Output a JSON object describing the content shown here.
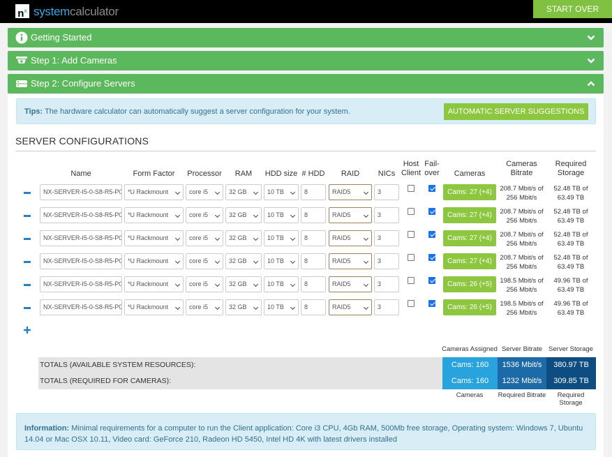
{
  "header": {
    "logo_mark": "n",
    "logo_sup": "x",
    "logo_brand": "system",
    "logo_rest": "calculator",
    "start_over_label": "START OVER"
  },
  "accordion": [
    {
      "label": "Getting Started",
      "icon": "info-circle-icon",
      "state": "collapsed"
    },
    {
      "label": "Step 1: Add Cameras",
      "icon": "camera-icon",
      "state": "collapsed"
    },
    {
      "label": "Step 2: Configure Servers",
      "icon": "server-icon",
      "state": "expanded"
    }
  ],
  "tips": {
    "label": "Tips:",
    "text": "The hardware calculator can automatically suggest a server configuration for your system.",
    "button": "AUTOMATIC SERVER SUGGESTIONS"
  },
  "section_title": "SERVER CONFIGURATIONS",
  "columns": {
    "name": "Name",
    "form_factor": "Form Factor",
    "processor": "Processor",
    "ram": "RAM",
    "hdd_size": "HDD size",
    "num_hdd": "# HDD",
    "raid": "RAID",
    "nics": "NICs",
    "host_client_1": "Host",
    "host_client_2": "Client",
    "failover_1": "Fail-",
    "failover_2": "over",
    "cameras": "Cameras",
    "bitrate_1": "Cameras",
    "bitrate_2": "Bitrate",
    "storage_1": "Required",
    "storage_2": "Storage"
  },
  "servers": [
    {
      "name": "NX-SERVER-I5-0-S8-R5-P0",
      "form_factor": "*U Rackmount",
      "processor": "core i5",
      "ram": "32 GB",
      "hdd_size": "10 TB",
      "num_hdd": "8",
      "raid": "RAID5",
      "nics": "3",
      "host_client": false,
      "failover": true,
      "cameras": "Cams: 27 (+4)",
      "bitrate_1": "208.7 Mbit/s of",
      "bitrate_2": "256 Mbit/s",
      "storage_1": "52.48 TB of",
      "storage_2": "63.49 TB"
    },
    {
      "name": "NX-SERVER-I5-0-S8-R5-P0",
      "form_factor": "*U Rackmount",
      "processor": "core i5",
      "ram": "32 GB",
      "hdd_size": "10 TB",
      "num_hdd": "8",
      "raid": "RAID5",
      "nics": "3",
      "host_client": false,
      "failover": true,
      "cameras": "Cams: 27 (+4)",
      "bitrate_1": "208.7 Mbit/s of",
      "bitrate_2": "256 Mbit/s",
      "storage_1": "52.48 TB of",
      "storage_2": "63.49 TB"
    },
    {
      "name": "NX-SERVER-I5-0-S8-R5-P0",
      "form_factor": "*U Rackmount",
      "processor": "core i5",
      "ram": "32 GB",
      "hdd_size": "10 TB",
      "num_hdd": "8",
      "raid": "RAID5",
      "nics": "3",
      "host_client": false,
      "failover": true,
      "cameras": "Cams: 27 (+4)",
      "bitrate_1": "208.7 Mbit/s of",
      "bitrate_2": "256 Mbit/s",
      "storage_1": "52.48 TB of",
      "storage_2": "63.49 TB"
    },
    {
      "name": "NX-SERVER-I5-0-S8-R5-P0",
      "form_factor": "*U Rackmount",
      "processor": "core i5",
      "ram": "32 GB",
      "hdd_size": "10 TB",
      "num_hdd": "8",
      "raid": "RAID5",
      "nics": "3",
      "host_client": false,
      "failover": true,
      "cameras": "Cams: 27 (+4)",
      "bitrate_1": "208.7 Mbit/s of",
      "bitrate_2": "256 Mbit/s",
      "storage_1": "52.48 TB of",
      "storage_2": "63.49 TB"
    },
    {
      "name": "NX-SERVER-I5-0-S8-R5-P0",
      "form_factor": "*U Rackmount",
      "processor": "core i5",
      "ram": "32 GB",
      "hdd_size": "10 TB",
      "num_hdd": "8",
      "raid": "RAID5",
      "nics": "3",
      "host_client": false,
      "failover": true,
      "cameras": "Cams: 26 (+5)",
      "bitrate_1": "198.5 Mbit/s of",
      "bitrate_2": "256 Mbit/s",
      "storage_1": "49.96 TB of",
      "storage_2": "63.49 TB"
    },
    {
      "name": "NX-SERVER-I5-0-S8-R5-P0",
      "form_factor": "*U Rackmount",
      "processor": "core i5",
      "ram": "32 GB",
      "hdd_size": "10 TB",
      "num_hdd": "8",
      "raid": "RAID5",
      "nics": "3",
      "host_client": false,
      "failover": true,
      "cameras": "Cams: 26 (+5)",
      "bitrate_1": "198.5 Mbit/s of",
      "bitrate_2": "256 Mbit/s",
      "storage_1": "49.96 TB of",
      "storage_2": "63.49 TB"
    }
  ],
  "totals": {
    "head_assigned": "Cameras Assigned",
    "head_bitrate": "Server Bitrate",
    "head_storage": "Server Storage",
    "available_label": "TOTALS (AVAILABLE SYSTEM RESOURCES):",
    "available_cams": "Cams: 160",
    "available_bitrate": "1536 Mbit/s",
    "available_storage": "380.97 TB",
    "required_label": "TOTALS (REQUIRED FOR CAMERAS):",
    "required_cams": "Cams: 160",
    "required_bitrate": "1232 Mbit/s",
    "required_storage": "309.85 TB",
    "foot_cameras": "Cameras",
    "foot_bitrate": "Required Bitrate",
    "foot_storage": "Required Storage"
  },
  "info": {
    "label": "Information:",
    "text": "Minimal requirements for a computer to run the Client application: Core i3 CPU, 4Gb RAM, 500Mb free storage, Operating system: Windows 7, Ubuntu 14.04 or Mac OSX 10.11, Video card: GeForce 210, Radeon HD 5450, Intel HD 4K with latest drivers installed"
  },
  "colors": {
    "accent_green": "#5cb85c",
    "button_green": "#8dc63f",
    "totals_light_blue": "#29a3dc",
    "totals_mid_blue": "#1d6aa8",
    "totals_dark_blue": "#0e4d82",
    "tips_bg": "#d9edf7"
  }
}
